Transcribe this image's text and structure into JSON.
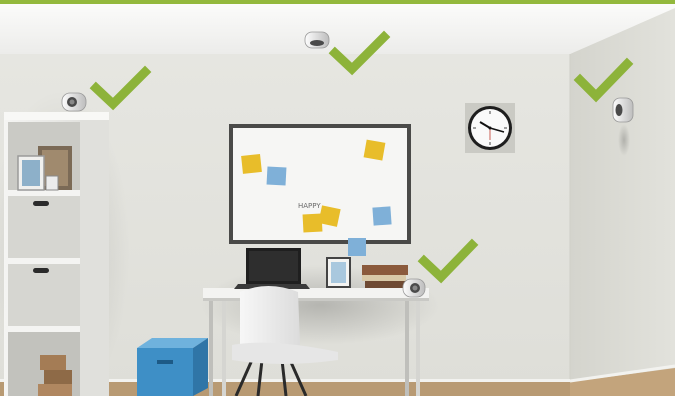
{
  "scene": {
    "whiteboard": {
      "note_text": "HAPPY"
    }
  },
  "placements": [
    {
      "name": "ceiling",
      "status": "approved"
    },
    {
      "name": "shelf-top",
      "status": "approved"
    },
    {
      "name": "right-wall",
      "status": "approved"
    },
    {
      "name": "desk",
      "status": "approved"
    }
  ],
  "colors": {
    "accent_green": "#8db33a",
    "top_bar": "#93b83c",
    "wall": "#e4e4df",
    "side_wall": "#dadad4",
    "ceiling": "#f3f3f1",
    "floor": "#b89a73",
    "sticky_yellow": "#e8bd2a",
    "sticky_blue": "#7fb0d8",
    "storage_box": "#3e8fc6"
  }
}
